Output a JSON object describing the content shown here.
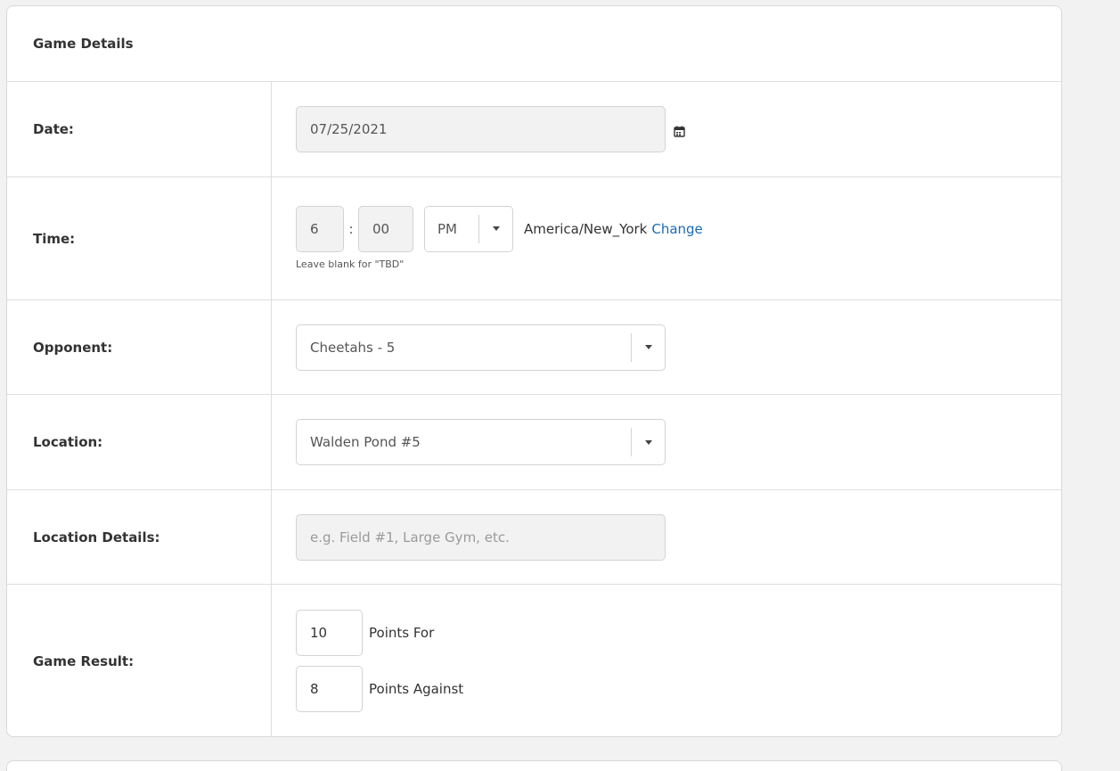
{
  "panel": {
    "title": "Game Details"
  },
  "date": {
    "label": "Date:",
    "value": "07/25/2021",
    "icon": "calendar-icon"
  },
  "time": {
    "label": "Time:",
    "hour": "6",
    "separator": ":",
    "minute": "00",
    "ampm": "PM",
    "timezone": "America/New_York",
    "change_link": "Change",
    "hint": "Leave blank for \"TBD\""
  },
  "opponent": {
    "label": "Opponent:",
    "value": "Cheetahs - 5"
  },
  "location": {
    "label": "Location:",
    "value": "Walden Pond #5"
  },
  "location_details": {
    "label": "Location Details:",
    "placeholder": "e.g. Field #1, Large Gym, etc."
  },
  "game_result": {
    "label": "Game Result:",
    "points_for": {
      "value": "10",
      "label": "Points For"
    },
    "points_against": {
      "value": "8",
      "label": "Points Against"
    }
  },
  "colors": {
    "link": "#1a6bb5",
    "readonly_bg": "#f2f2f2",
    "border": "#d3d3d3"
  }
}
